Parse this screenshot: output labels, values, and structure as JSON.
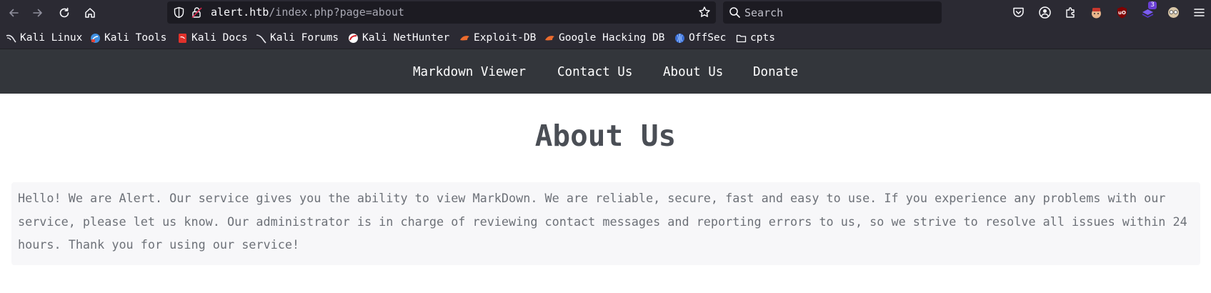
{
  "browser": {
    "url": {
      "host": "alert.htb",
      "path": "/index.php?page=about"
    },
    "search": {
      "placeholder": "Search"
    },
    "toolbar_icons": [
      "back-icon",
      "forward-icon",
      "reload-icon",
      "home-icon"
    ],
    "extension_icons": [
      "pocket-icon",
      "account-icon",
      "extensions-icon",
      "hackbar-icon",
      "ublock-icon",
      "extension-badge-icon",
      "foxyproxy-icon",
      "menu-icon"
    ],
    "extension_badge_count": "3",
    "bookmarks": [
      {
        "label": "Kali Linux",
        "icon": "kali-dragon-icon"
      },
      {
        "label": "Kali Tools",
        "icon": "kali-tools-icon"
      },
      {
        "label": "Kali Docs",
        "icon": "kali-docs-icon"
      },
      {
        "label": "Kali Forums",
        "icon": "kali-forums-icon"
      },
      {
        "label": "Kali NetHunter",
        "icon": "nethunter-icon"
      },
      {
        "label": "Exploit-DB",
        "icon": "exploit-db-icon"
      },
      {
        "label": "Google Hacking DB",
        "icon": "ghdb-icon"
      },
      {
        "label": "OffSec",
        "icon": "offsec-icon"
      },
      {
        "label": "cpts",
        "icon": "folder-icon"
      }
    ]
  },
  "site": {
    "nav": [
      {
        "label": "Markdown Viewer"
      },
      {
        "label": "Contact Us"
      },
      {
        "label": "About Us"
      },
      {
        "label": "Donate"
      }
    ],
    "title": "About Us",
    "about_text": "Hello! We are Alert. Our service gives you the ability to view MarkDown. We are reliable, secure, fast and easy to use. If you experience any problems with our service, please let us know. Our administrator is in charge of reviewing contact messages and reporting errors to us, so we strive to resolve all issues within 24 hours. Thank you for using our service!"
  },
  "colors": {
    "chrome_bg": "#2b2a33",
    "urlbar_bg": "#1c1b22",
    "nav_bg": "#33363b",
    "title_color": "#4a4e55",
    "text_color": "#6d7178",
    "box_bg": "#f7f7f9"
  }
}
